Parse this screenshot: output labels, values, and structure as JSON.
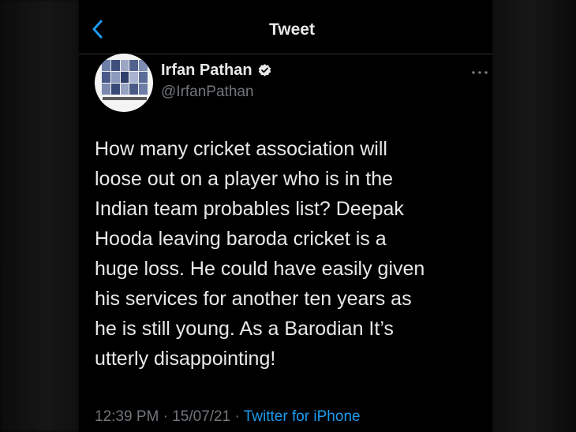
{
  "header": {
    "back_icon": "chevron-left-icon",
    "title": "Tweet"
  },
  "author": {
    "display_name": "Irfan Pathan",
    "handle": "@IrfanPathan",
    "verified_icon": "verified-badge-icon",
    "avatar_icon": "profile-avatar"
  },
  "more_icon": "more-horizontal-icon",
  "tweet": {
    "text": "How many cricket association will\nloose out on a player who is in the\nIndian team probables list? Deepak\nHooda leaving baroda cricket is a\nhuge loss. He could have easily given\nhis services for another ten years as\nhe is still young. As a Barodian It’s\nutterly disappointing!"
  },
  "meta": {
    "time": "12:39 PM",
    "separator": " · ",
    "date": "15/07/21",
    "source": "Twitter for iPhone"
  },
  "colors": {
    "background": "#000000",
    "text_primary": "#e7e9ea",
    "text_secondary": "#71767b",
    "accent": "#1d9bf0"
  }
}
